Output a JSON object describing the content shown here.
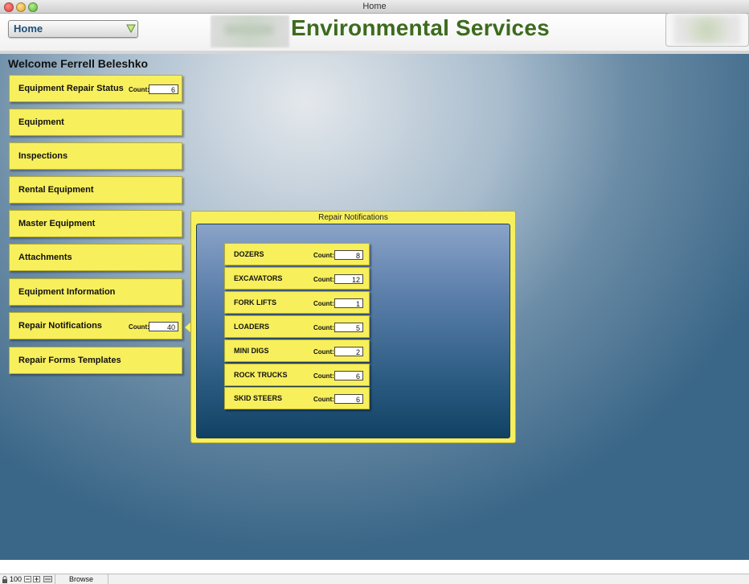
{
  "window": {
    "title": "Home"
  },
  "header": {
    "home_select": "Home",
    "brand": "Environmental Services"
  },
  "welcome": "Welcome Ferrell Beleshko",
  "count_label": "Count:",
  "menu": [
    {
      "label": "Equipment Repair Status",
      "count": "6"
    },
    {
      "label": "Equipment"
    },
    {
      "label": "Inspections"
    },
    {
      "label": "Rental Equipment"
    },
    {
      "label": "Master Equipment"
    },
    {
      "label": "Attachments"
    },
    {
      "label": "Equipment Information"
    },
    {
      "label": "Repair Notifications",
      "count": "40"
    },
    {
      "label": "Repair Forms Templates"
    }
  ],
  "popover": {
    "title": "Repair Notifications",
    "items": [
      {
        "label": "DOZERS",
        "count": "8"
      },
      {
        "label": "EXCAVATORS",
        "count": "12"
      },
      {
        "label": "FORK LIFTS",
        "count": "1"
      },
      {
        "label": "LOADERS",
        "count": "5"
      },
      {
        "label": "MINI DIGS",
        "count": "2"
      },
      {
        "label": "ROCK TRUCKS",
        "count": "6"
      },
      {
        "label": "SKID STEERS",
        "count": "6"
      }
    ]
  },
  "statusbar": {
    "zoom": "100",
    "mode": "Browse"
  },
  "colors": {
    "button_yellow": "#f7ef5c",
    "brand_green": "#3d6b1e",
    "home_blue": "#1c4f7a"
  }
}
